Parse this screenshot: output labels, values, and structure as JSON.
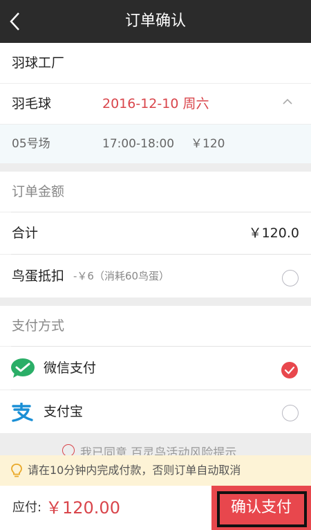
{
  "header": {
    "title": "订单确认"
  },
  "venue": {
    "name": "羽球工厂"
  },
  "booking": {
    "sport": "羽毛球",
    "date": "2016-12-10 周六",
    "court": "05号场",
    "time": "17:00-18:00",
    "price": "￥120"
  },
  "amount": {
    "section_title": "订单金额",
    "total_label": "合计",
    "total_value": "￥120.0",
    "egg_label": "鸟蛋抵扣",
    "egg_note": "-￥6（消耗60鸟蛋）"
  },
  "payment": {
    "section_title": "支付方式",
    "methods": [
      {
        "label": "微信支付",
        "selected": true
      },
      {
        "label": "支付宝",
        "selected": false
      }
    ]
  },
  "agreement": {
    "text": "我已同意 百灵鸟活动风险提示"
  },
  "notice": {
    "text": "请在10分钟内完成付款，否则订单自动取消"
  },
  "footer": {
    "due_label": "应付:",
    "due_amount": "￥120.00",
    "pay_button": "确认支付"
  },
  "colors": {
    "accent": "#d9454b",
    "header": "#2b2b2b",
    "wechat": "#2aae67",
    "alipay": "#1a8fd5"
  }
}
